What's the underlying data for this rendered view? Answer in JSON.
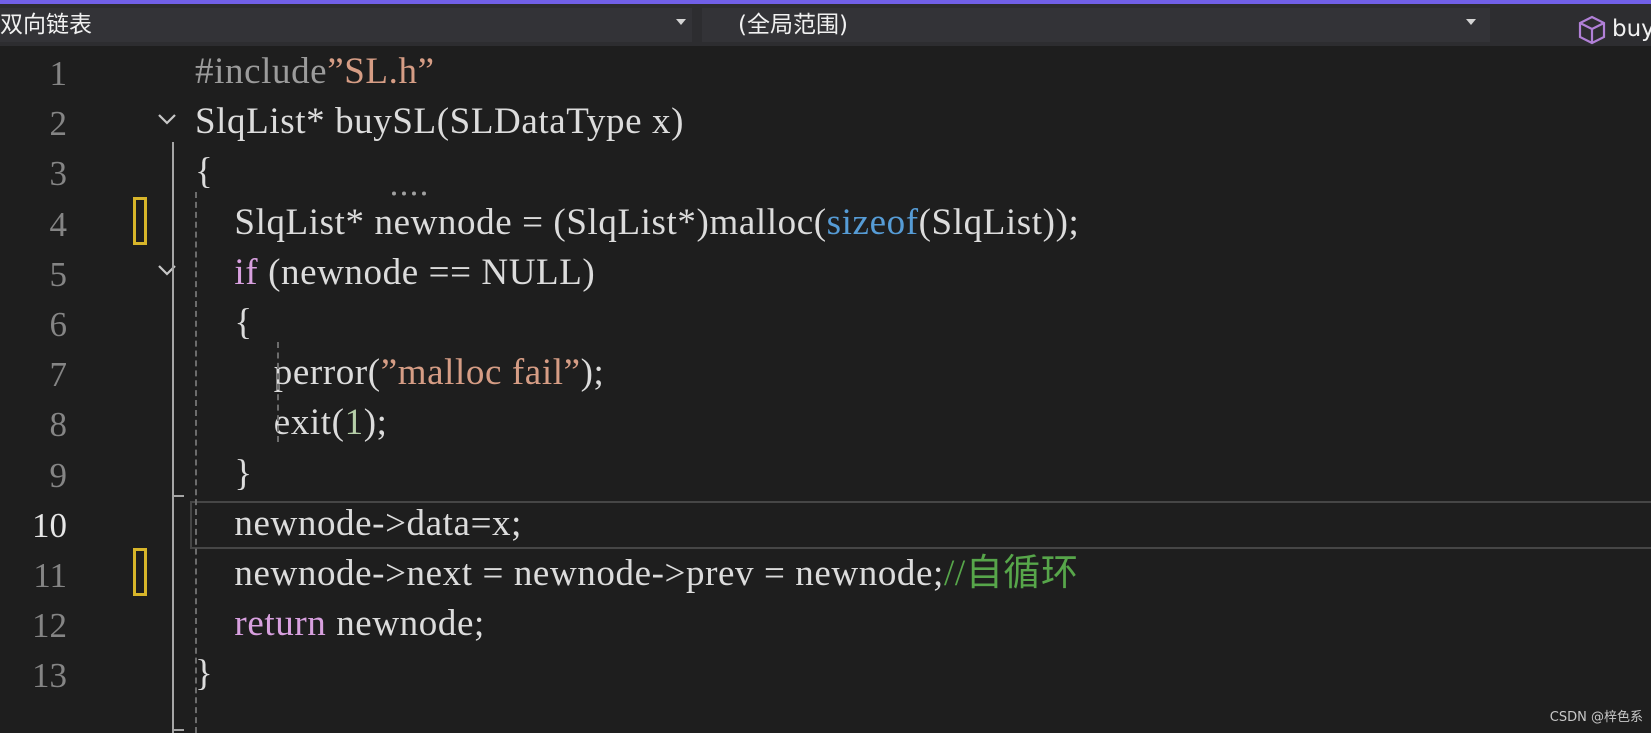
{
  "navbar": {
    "project_label": "双向链表",
    "scope_label": "(全局范围)",
    "member_label": "buySL"
  },
  "editor": {
    "current_line": 10,
    "lines": [
      {
        "n": "1",
        "tokens": [
          {
            "t": "#include",
            "c": "pp"
          },
          {
            "t": "”SL.h”",
            "c": "str"
          }
        ]
      },
      {
        "n": "2",
        "tokens": [
          {
            "t": "SlqList* buySL(SLDataType x)",
            "c": "plain"
          }
        ]
      },
      {
        "n": "3",
        "tokens": [
          {
            "t": "{",
            "c": "plain"
          }
        ]
      },
      {
        "n": "4",
        "tokens": [
          {
            "t": "    SlqList* newnode = (SlqList*)malloc(",
            "c": "plain"
          },
          {
            "t": "sizeof",
            "c": "kwb"
          },
          {
            "t": "(SlqList));",
            "c": "plain"
          }
        ]
      },
      {
        "n": "5",
        "tokens": [
          {
            "t": "    ",
            "c": "plain"
          },
          {
            "t": "if",
            "c": "kw"
          },
          {
            "t": " (newnode == NULL)",
            "c": "plain"
          }
        ]
      },
      {
        "n": "6",
        "tokens": [
          {
            "t": "    {",
            "c": "plain"
          }
        ]
      },
      {
        "n": "7",
        "tokens": [
          {
            "t": "        perror(",
            "c": "plain"
          },
          {
            "t": "”malloc fail”",
            "c": "str"
          },
          {
            "t": ");",
            "c": "plain"
          }
        ]
      },
      {
        "n": "8",
        "tokens": [
          {
            "t": "        exit(",
            "c": "plain"
          },
          {
            "t": "1",
            "c": "num"
          },
          {
            "t": ");",
            "c": "plain"
          }
        ]
      },
      {
        "n": "9",
        "tokens": [
          {
            "t": "    }",
            "c": "plain"
          }
        ]
      },
      {
        "n": "10",
        "tokens": [
          {
            "t": "    newnode->data=x;",
            "c": "plain"
          }
        ]
      },
      {
        "n": "11",
        "tokens": [
          {
            "t": "    newnode->next = newnode->prev = newnode;",
            "c": "plain"
          },
          {
            "t": "//自循环",
            "c": "cmt"
          }
        ]
      },
      {
        "n": "12",
        "tokens": [
          {
            "t": "    ",
            "c": "plain"
          },
          {
            "t": "return",
            "c": "kw"
          },
          {
            "t": " newnode;",
            "c": "plain"
          }
        ]
      },
      {
        "n": "13",
        "tokens": [
          {
            "t": "}",
            "c": "plain"
          }
        ]
      }
    ]
  },
  "watermark": "CSDN @梓色系",
  "colors": {
    "accent": "#7160e8",
    "background": "#1e1e1e",
    "keyword": "#d8a0df",
    "keyword_blue": "#569cd6",
    "string": "#d69d85",
    "comment": "#57a64a",
    "number": "#b5cea8",
    "change_marker": "#d7b52a"
  },
  "icons": {
    "member_icon": "cube-icon",
    "fold_icon": "chevron-down-icon"
  }
}
